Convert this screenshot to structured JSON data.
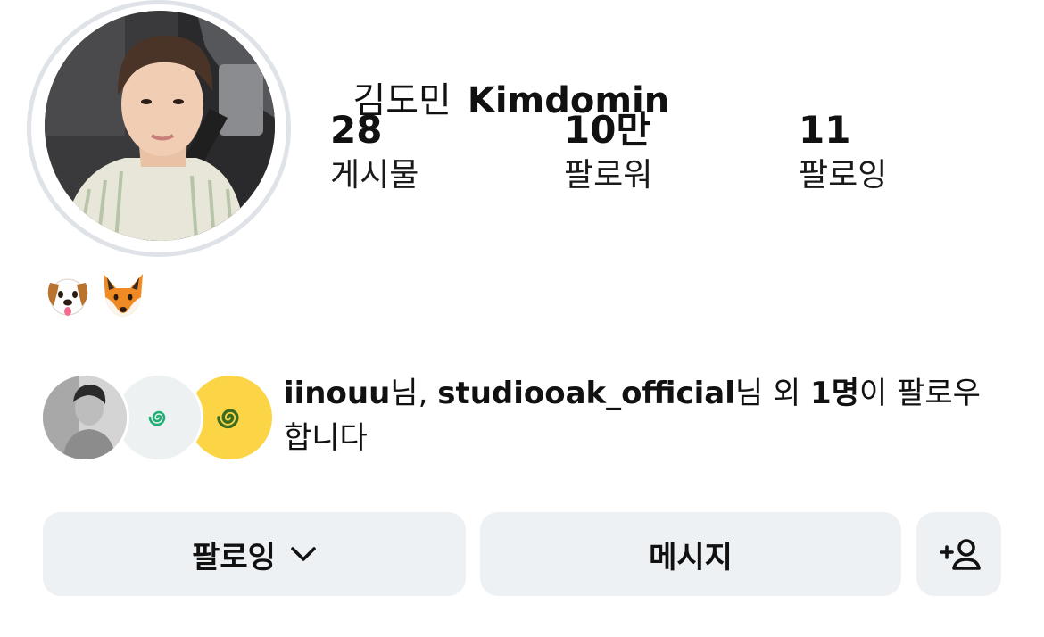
{
  "profile": {
    "name_ko": "김도민",
    "name_en": "Kimdomin"
  },
  "stats": {
    "posts": {
      "value": "28",
      "label": "게시물"
    },
    "followers": {
      "value": "10만",
      "label": "팔로워"
    },
    "following": {
      "value": "11",
      "label": "팔로잉"
    }
  },
  "bio": {
    "emojis": [
      "🐶",
      "🦊"
    ]
  },
  "mutual": {
    "user1": "iinouu",
    "suffix1": "님, ",
    "user2": "studiooak_official",
    "suffix2": "님 외 ",
    "count": "1명",
    "suffix3": "이 팔로우합니다"
  },
  "buttons": {
    "follow_label": "팔로잉",
    "message_label": "메시지",
    "add_icon": "add-person-icon"
  },
  "colors": {
    "button_bg": "#eef1f4",
    "avatar_ring": "#dfe3e8",
    "mutual_yellow": "#fbd546",
    "mutual_swirl_green": "#1fae74"
  }
}
